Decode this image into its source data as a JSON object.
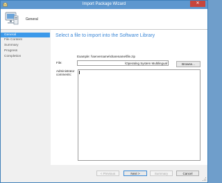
{
  "window": {
    "title": "Import Package Wizard",
    "close_glyph": "✕",
    "icon": "package-icon"
  },
  "header": {
    "title": "General",
    "icon": "computer-monitor-icon"
  },
  "sidebar": {
    "items": [
      {
        "label": "General",
        "active": true
      },
      {
        "label": "File Content",
        "active": false
      },
      {
        "label": "Summary",
        "active": false
      },
      {
        "label": "Progress",
        "active": false
      },
      {
        "label": "Completion",
        "active": false
      }
    ]
  },
  "main": {
    "heading": "Select a file to import into the Software Library",
    "example": "Example: \\\\servername\\sharename\\file.zip",
    "file_label": "File:",
    "file_value": "\\Operating System Multilingual",
    "browse_label": "Browse...",
    "admin_label": "Administrator comments:",
    "comments_value": ""
  },
  "footer": {
    "previous_label": "< Previous",
    "next_label": "Next >",
    "summary_label": "Summary",
    "cancel_label": "Cancel"
  },
  "colors": {
    "accent": "#3b99ea",
    "heading": "#3a86d6",
    "titlebar": "#5d97cf",
    "close": "#c7463d"
  }
}
